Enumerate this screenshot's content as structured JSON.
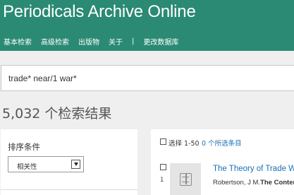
{
  "header": {
    "app_title": "Periodicals Archive Online",
    "nav": [
      "基本检索",
      "高级检索",
      "出版物",
      "关于",
      "|",
      "更改数据库"
    ]
  },
  "search": {
    "value": "trade* near/1 war*"
  },
  "results": {
    "count_text": "5,032 个检索结果"
  },
  "sort": {
    "label": "排序条件",
    "selected": "相关性"
  },
  "toolbar": {
    "select_range": "选择 1-50",
    "selected_items": "0 个所选条目"
  },
  "items": [
    {
      "number": "1",
      "title": "The Theory of Trade War",
      "author": "Robertson, J M.",
      "source": "The Contemp"
    }
  ]
}
